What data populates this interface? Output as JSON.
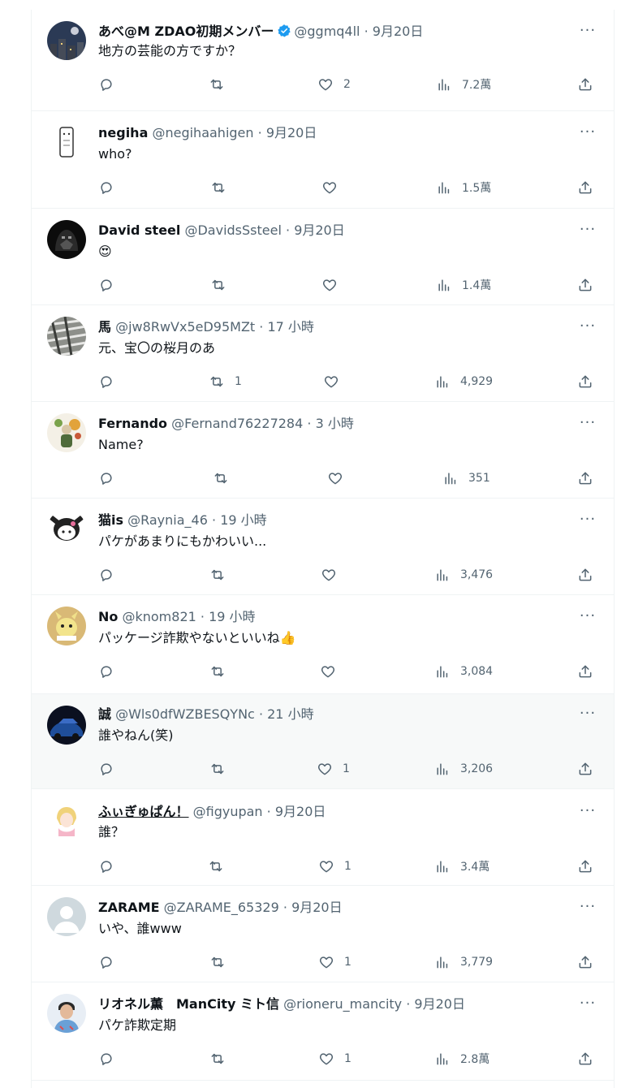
{
  "tweets": [
    {
      "name": "あべ@M ZDAO初期メンバー",
      "verified": true,
      "handle": "@ggmq4ll",
      "dot": "·",
      "time": "9月20日",
      "text": "地方の芸能の方ですか？",
      "replies": "",
      "retweets": "",
      "likes": "2",
      "views": "7.2萬",
      "name_underline": false,
      "highlight": false,
      "avatar": "night-city-avatar"
    },
    {
      "name": "negiha",
      "verified": false,
      "handle": "@negihaahigen",
      "dot": "·",
      "time": "9月20日",
      "text": "who?",
      "replies": "",
      "retweets": "",
      "likes": "",
      "views": "1.5萬",
      "name_underline": false,
      "highlight": false,
      "avatar": "sketch-figure-avatar"
    },
    {
      "name": "David steel",
      "verified": false,
      "handle": "@DavidsSsteel",
      "dot": "·",
      "time": "9月20日",
      "text": "😍",
      "replies": "",
      "retweets": "",
      "likes": "",
      "views": "1.4萬",
      "name_underline": false,
      "highlight": false,
      "avatar": "dark-helmet-avatar"
    },
    {
      "name": "馬",
      "verified": false,
      "handle": "@jw8RwVx5eD95MZt",
      "dot": "·",
      "time": "17 小時",
      "text": "元、宝〇の桜月のあ",
      "replies": "",
      "retweets": "1",
      "likes": "",
      "views": "4,929",
      "name_underline": false,
      "highlight": false,
      "avatar": "zebra-avatar"
    },
    {
      "name": "Fernando",
      "verified": false,
      "handle": "@Fernand76227284",
      "dot": "·",
      "time": "3 小時",
      "text": "Name?",
      "replies": "",
      "retweets": "",
      "likes": "",
      "views": "351",
      "name_underline": false,
      "highlight": false,
      "avatar": "flower-figure-avatar"
    },
    {
      "name": "猫is",
      "verified": false,
      "handle": "@Raynia_46",
      "dot": "·",
      "time": "19 小時",
      "text": "パケがあまりにもかわいい...",
      "replies": "",
      "retweets": "",
      "likes": "",
      "views": "3,476",
      "name_underline": false,
      "highlight": false,
      "avatar": "cartoon-character-avatar"
    },
    {
      "name": "No",
      "verified": false,
      "handle": "@knom821",
      "dot": "·",
      "time": "19 小時",
      "text": "パッケージ詐欺やないといいね👍",
      "replies": "",
      "retweets": "",
      "likes": "",
      "views": "3,084",
      "name_underline": false,
      "highlight": false,
      "avatar": "mascot-avatar"
    },
    {
      "name": "誠",
      "verified": false,
      "handle": "@Wls0dfWZBESQYNc",
      "dot": "·",
      "time": "21 小時",
      "text": "誰やねん(笑)",
      "replies": "",
      "retweets": "",
      "likes": "1",
      "views": "3,206",
      "name_underline": false,
      "highlight": true,
      "avatar": "blue-car-avatar"
    },
    {
      "name": "ふぃぎゅぱん！",
      "verified": false,
      "handle": "@figyupan",
      "dot": "·",
      "time": "9月20日",
      "text": "誰？",
      "replies": "",
      "retweets": "",
      "likes": "1",
      "views": "3.4萬",
      "name_underline": true,
      "highlight": false,
      "avatar": "anime-figure-avatar"
    },
    {
      "name": "ZARAME",
      "verified": false,
      "handle": "@ZARAME_65329",
      "dot": "·",
      "time": "9月20日",
      "text": "いや、誰www",
      "replies": "",
      "retweets": "",
      "likes": "1",
      "views": "3,779",
      "name_underline": false,
      "highlight": false,
      "avatar": "default-person-avatar"
    },
    {
      "name": "リオネル薫　ManCity ミト信",
      "verified": false,
      "handle": "@rioneru_mancity",
      "dot": "·",
      "time": "9月20日",
      "text": "パケ詐欺定期",
      "replies": "",
      "retweets": "",
      "likes": "1",
      "views": "2.8萬",
      "name_underline": false,
      "highlight": false,
      "avatar": "person-photo-avatar"
    }
  ],
  "more_glyph": "···",
  "colors": {
    "text": "#0f1419",
    "secondary": "#536471",
    "border": "#eff3f4",
    "verified": "#1d9bf0",
    "highlight_bg": "#f7f9f9"
  }
}
